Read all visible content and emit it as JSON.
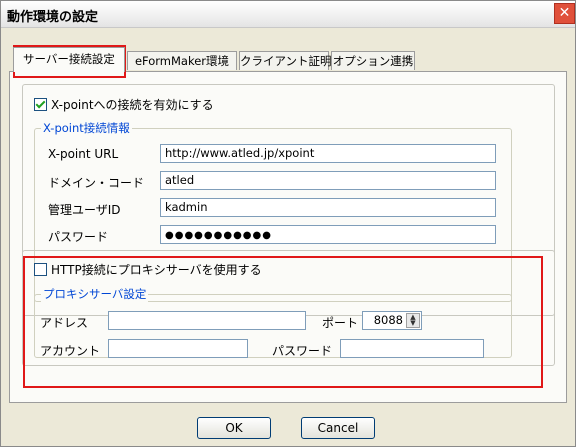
{
  "window": {
    "title": "動作環境の設定",
    "close_glyph": "✕"
  },
  "tabs": [
    {
      "label": "サーバー接続設定"
    },
    {
      "label": "eFormMaker環境"
    },
    {
      "label": "クライアント証明"
    },
    {
      "label": "オプション連携"
    }
  ],
  "xpoint": {
    "enable_label": "X-pointへの接続を有効にする",
    "enabled": true,
    "group_title": "X-point接続情報",
    "url_label": "X-point URL",
    "url_value": "http://www.atled.jp/xpoint",
    "domain_label": "ドメイン・コード",
    "domain_value": "atled",
    "admin_label": "管理ユーザID",
    "admin_value": "kadmin",
    "password_label": "パスワード",
    "password_value": "●●●●●●●●●●●"
  },
  "proxy": {
    "enable_label": "HTTP接続にプロキシサーバを使用する",
    "enabled": false,
    "group_title": "プロキシサーバ設定",
    "address_label": "アドレス",
    "address_value": "",
    "port_label": "ポート",
    "port_value": "8088",
    "account_label": "アカウント",
    "account_value": "",
    "password_label": "パスワード",
    "password_value": ""
  },
  "buttons": {
    "ok": "OK",
    "cancel": "Cancel"
  },
  "colors": {
    "highlight": "#e01818",
    "group_title": "#0046d5"
  }
}
